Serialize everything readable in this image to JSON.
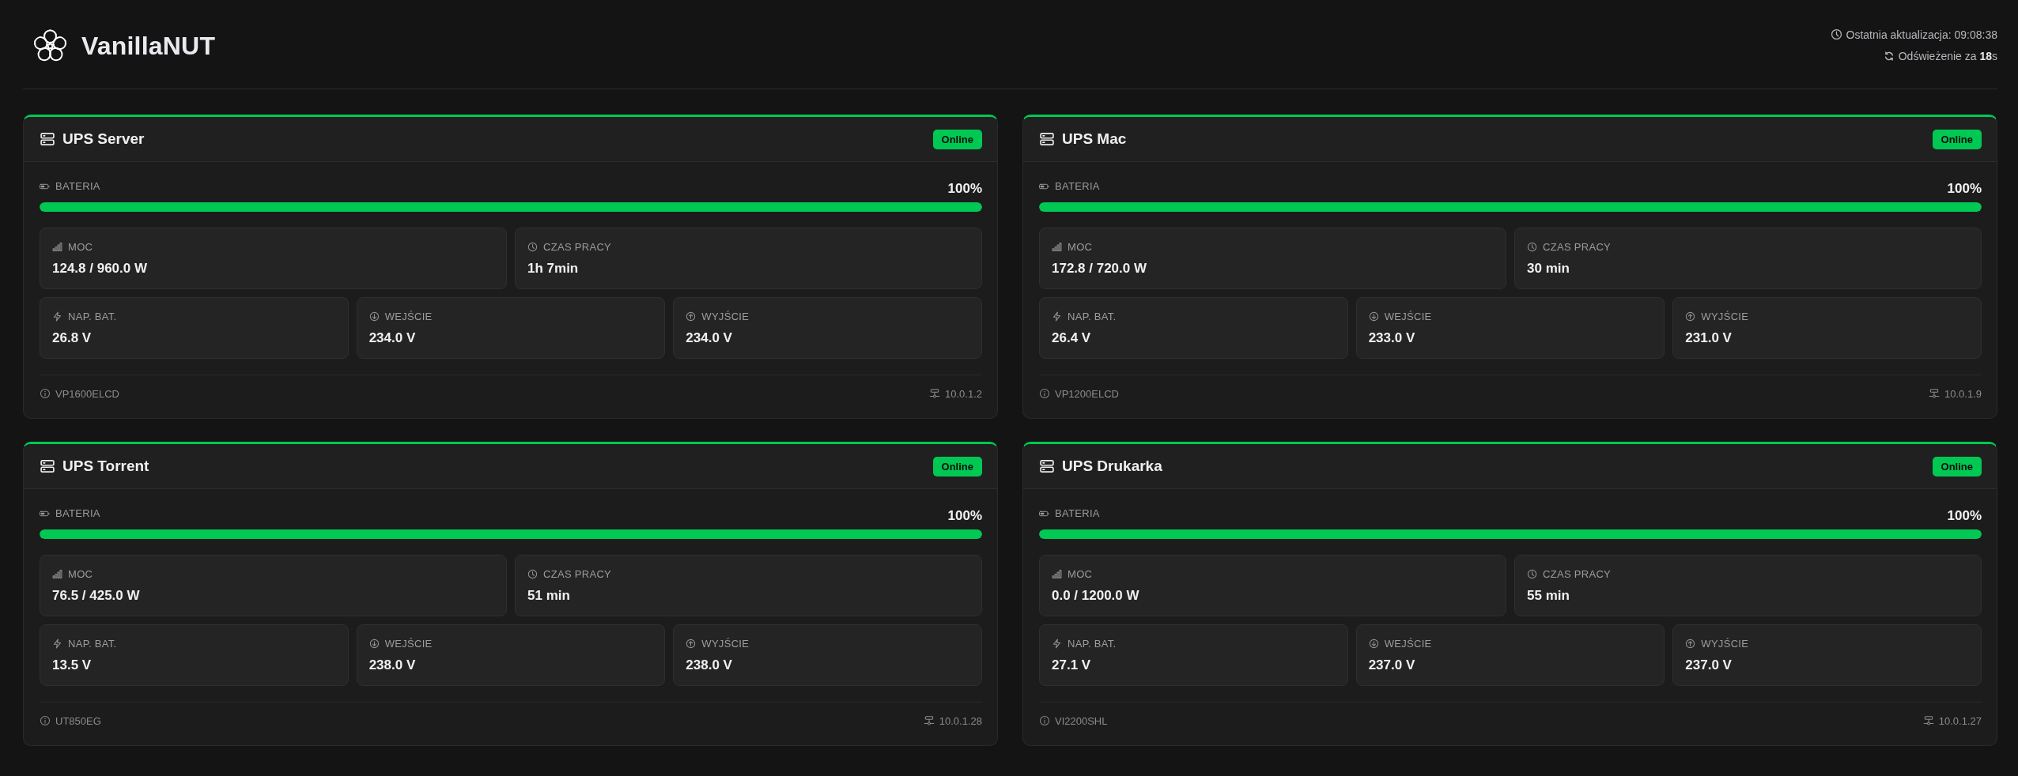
{
  "header": {
    "title": "VanillaNUT",
    "last_update": "Ostatnia aktualizacja: 09:08:38",
    "refresh": "Odświeżenie za **18**s"
  },
  "devices": [
    {
      "name": "UPS Server",
      "status": "Online",
      "battery": {
        "label": "BATERIA",
        "reading": "100%",
        "level": 1
      },
      "metric_rows": [
        [
          {
            "kind": "power",
            "label": "MOC",
            "value": "124.8 / 960.0 W"
          },
          {
            "kind": "runtime",
            "label": "CZAS PRACY",
            "value": "1h 7min"
          }
        ],
        [
          {
            "kind": "battery_voltage",
            "label": "NAP. BAT.",
            "value": "26.8 V"
          },
          {
            "kind": "input",
            "label": "WEJŚCIE",
            "value": "234.0 V"
          },
          {
            "kind": "output",
            "label": "WYJŚCIE",
            "value": "234.0 V"
          }
        ]
      ],
      "model": "VP1600ELCD",
      "address": "10.0.1.2"
    },
    {
      "name": "UPS Mac",
      "status": "Online",
      "battery": {
        "label": "BATERIA",
        "reading": "100%",
        "level": 1
      },
      "metric_rows": [
        [
          {
            "kind": "power",
            "label": "MOC",
            "value": "172.8 / 720.0 W"
          },
          {
            "kind": "runtime",
            "label": "CZAS PRACY",
            "value": "30 min"
          }
        ],
        [
          {
            "kind": "battery_voltage",
            "label": "NAP. BAT.",
            "value": "26.4 V"
          },
          {
            "kind": "input",
            "label": "WEJŚCIE",
            "value": "233.0 V"
          },
          {
            "kind": "output",
            "label": "WYJŚCIE",
            "value": "231.0 V"
          }
        ]
      ],
      "model": "VP1200ELCD",
      "address": "10.0.1.9"
    },
    {
      "name": "UPS Torrent",
      "status": "Online",
      "battery": {
        "label": "BATERIA",
        "reading": "100%",
        "level": 1
      },
      "metric_rows": [
        [
          {
            "kind": "power",
            "label": "MOC",
            "value": "76.5 / 425.0 W"
          },
          {
            "kind": "runtime",
            "label": "CZAS PRACY",
            "value": "51 min"
          }
        ],
        [
          {
            "kind": "battery_voltage",
            "label": "NAP. BAT.",
            "value": "13.5 V"
          },
          {
            "kind": "input",
            "label": "WEJŚCIE",
            "value": "238.0 V"
          },
          {
            "kind": "output",
            "label": "WYJŚCIE",
            "value": "238.0 V"
          }
        ]
      ],
      "model": "UT850EG",
      "address": "10.0.1.28"
    },
    {
      "name": "UPS Drukarka",
      "status": "Online",
      "battery": {
        "label": "BATERIA",
        "reading": "100%",
        "level": 1
      },
      "metric_rows": [
        [
          {
            "kind": "power",
            "label": "MOC",
            "value": "0.0 / 1200.0 W"
          },
          {
            "kind": "runtime",
            "label": "CZAS PRACY",
            "value": "55 min"
          }
        ],
        [
          {
            "kind": "battery_voltage",
            "label": "NAP. BAT.",
            "value": "27.1 V"
          },
          {
            "kind": "input",
            "label": "WEJŚCIE",
            "value": "237.0 V"
          },
          {
            "kind": "output",
            "label": "WYJŚCIE",
            "value": "237.0 V"
          }
        ]
      ],
      "model": "VI2200SHL",
      "address": "10.0.1.27"
    }
  ]
}
